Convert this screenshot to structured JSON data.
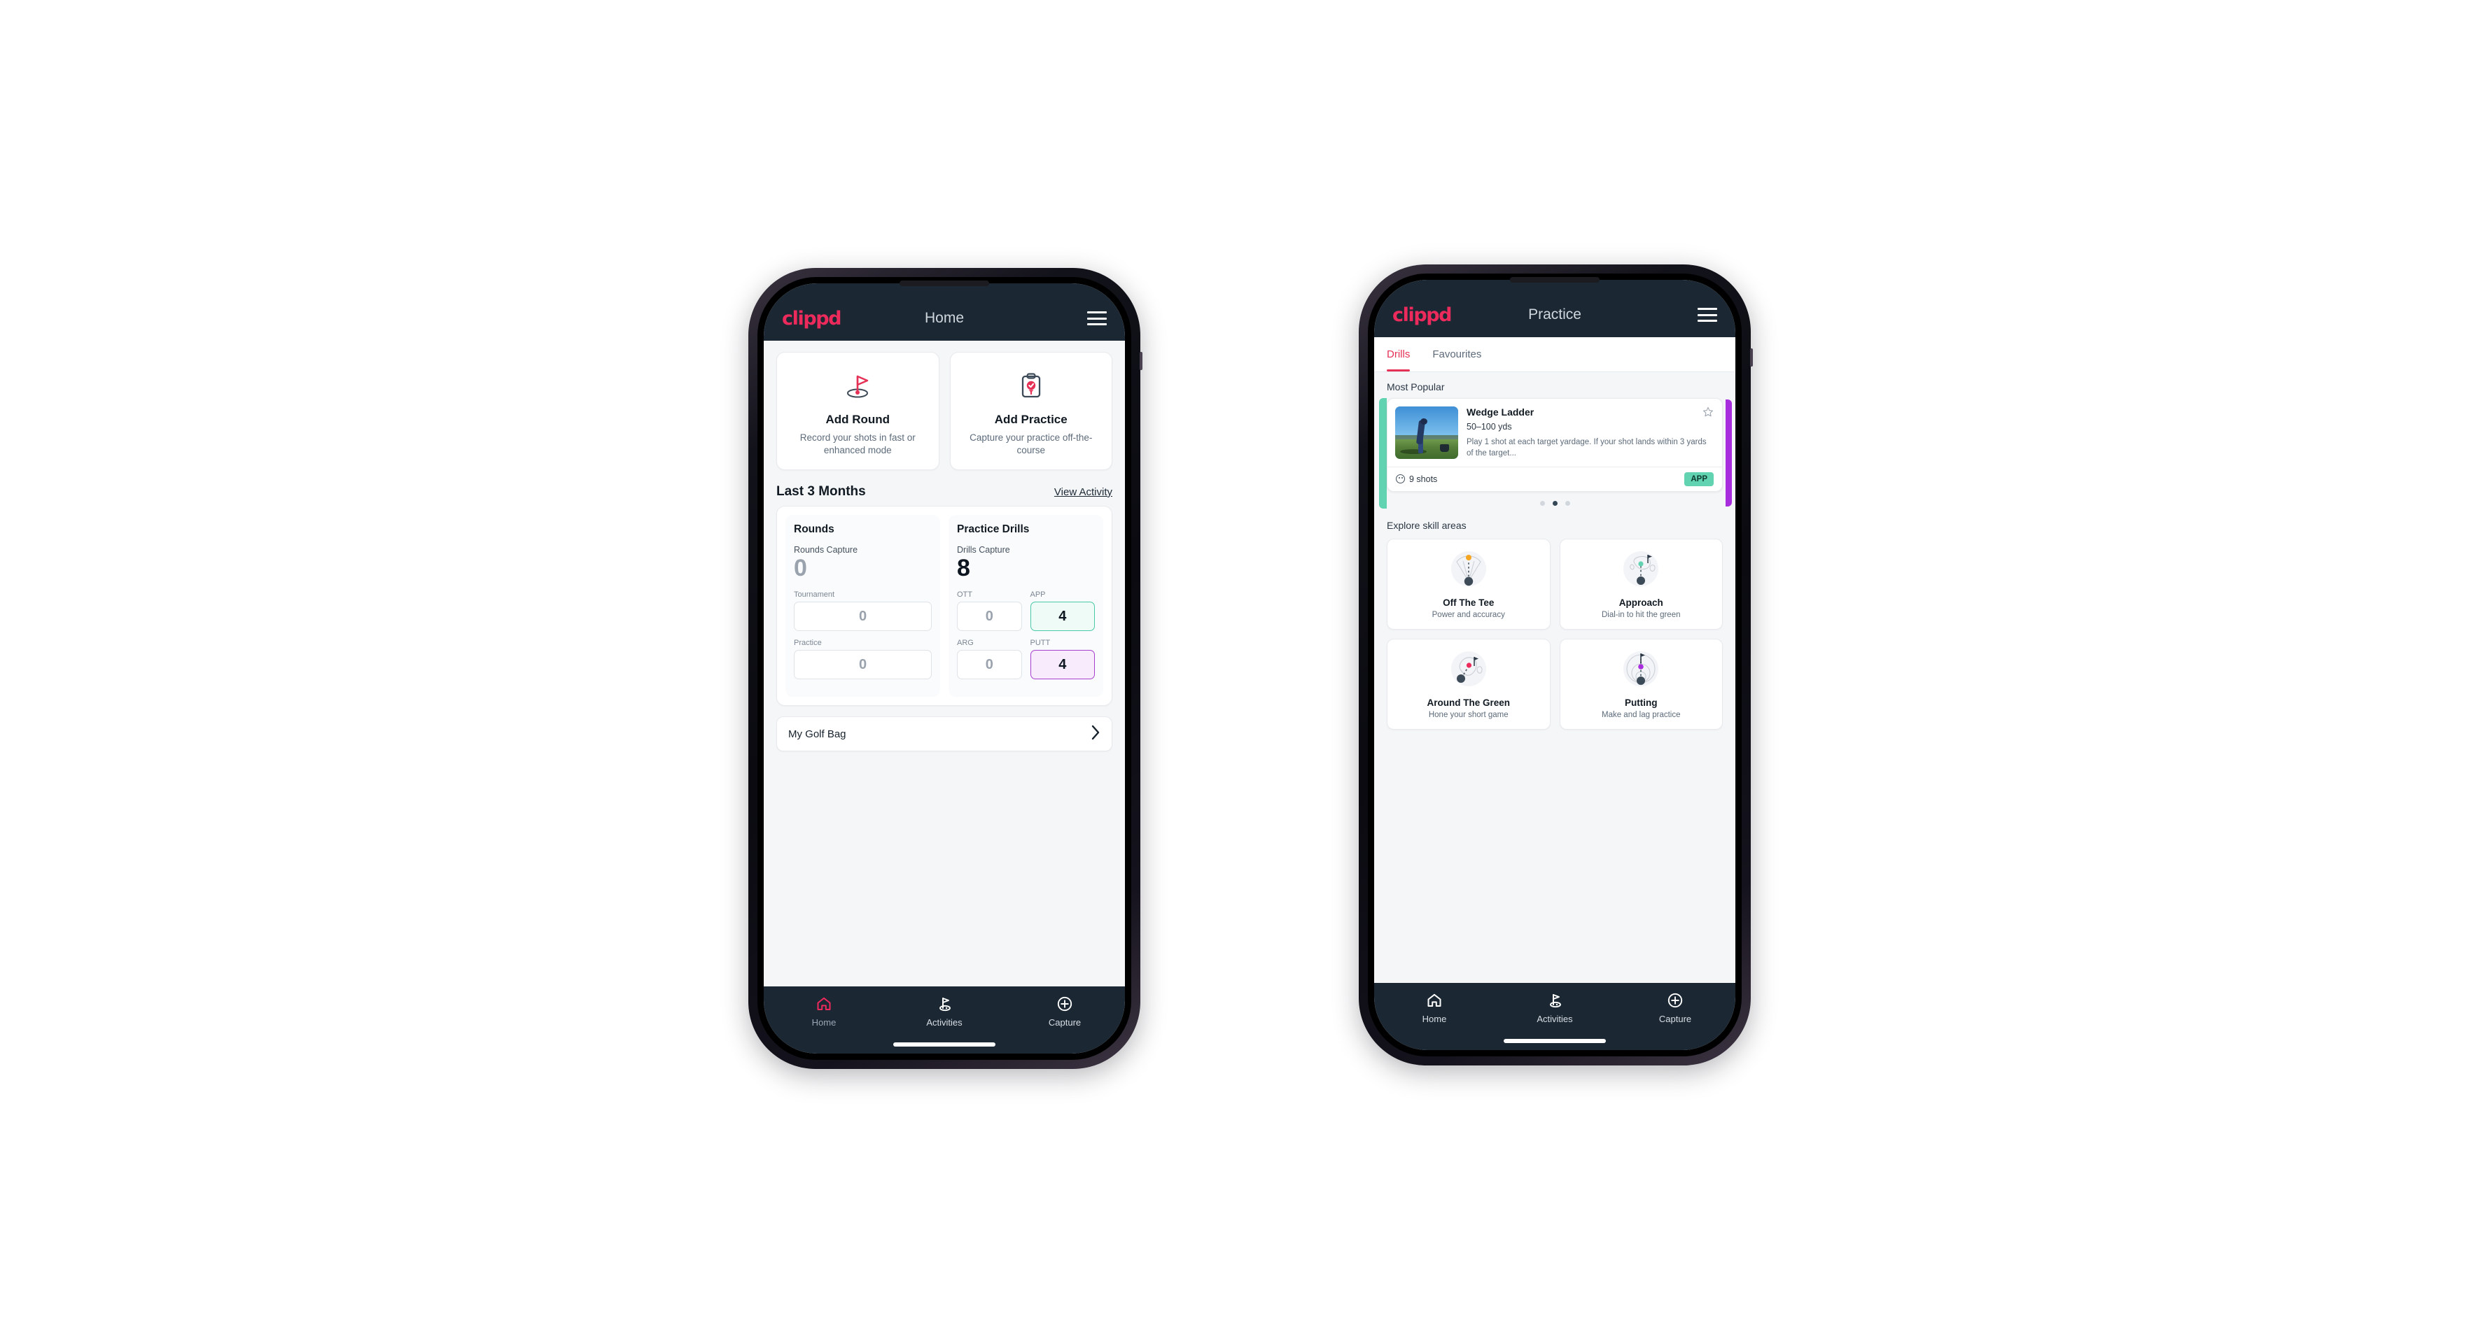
{
  "brand": {
    "logo_text": "clippd",
    "accent": "#ec2a5b",
    "dark": "#1b2834",
    "teal": "#62d3b0",
    "purple": "#a82ddd"
  },
  "phone_home": {
    "appbar": {
      "title": "Home",
      "menu_icon": "hamburger-icon"
    },
    "quick_actions": [
      {
        "icon": "golf-flag-icon",
        "title": "Add Round",
        "subtitle": "Record your shots in fast or enhanced mode"
      },
      {
        "icon": "clipboard-check-icon",
        "title": "Add Practice",
        "subtitle": "Capture your practice off-the-course"
      }
    ],
    "section": {
      "title": "Last 3 Months",
      "link": "View Activity"
    },
    "rounds": {
      "heading": "Rounds",
      "capture_label": "Rounds Capture",
      "capture_value": "0",
      "metrics": [
        {
          "label": "Tournament",
          "value": "0",
          "accent": "none"
        },
        {
          "label": "Practice",
          "value": "0",
          "accent": "none"
        }
      ]
    },
    "drills": {
      "heading": "Practice Drills",
      "capture_label": "Drills Capture",
      "capture_value": "8",
      "metrics": [
        {
          "label": "OTT",
          "value": "0",
          "accent": "none"
        },
        {
          "label": "APP",
          "value": "4",
          "accent": "teal"
        },
        {
          "label": "ARG",
          "value": "0",
          "accent": "none"
        },
        {
          "label": "PUTT",
          "value": "4",
          "accent": "purple"
        }
      ]
    },
    "golf_bag": {
      "label": "My Golf Bag",
      "chevron": "chevron-right-icon"
    },
    "bottom_nav": [
      {
        "icon": "home-icon",
        "label": "Home",
        "active": true
      },
      {
        "icon": "golf-flag-icon",
        "label": "Activities",
        "active": false
      },
      {
        "icon": "plus-circle-icon",
        "label": "Capture",
        "active": false
      }
    ]
  },
  "phone_practice": {
    "appbar": {
      "title": "Practice",
      "menu_icon": "hamburger-icon"
    },
    "tabs": [
      {
        "label": "Drills",
        "active": true
      },
      {
        "label": "Favourites",
        "active": false
      }
    ],
    "most_popular_label": "Most Popular",
    "drill_card": {
      "title": "Wedge Ladder",
      "yardage": "50–100 yds",
      "description": "Play 1 shot at each target yardage. If your shot lands within 3 yards of the target...",
      "shots": "9 shots",
      "tag": "APP",
      "star_icon": "star-outline-icon",
      "shots_icon": "golf-ball-icon"
    },
    "carousel_dots": {
      "count": 3,
      "active_index": 1
    },
    "skill_section_label": "Explore skill areas",
    "skill_areas": [
      {
        "name": "Off The Tee",
        "desc": "Power and accuracy",
        "art": "tee-fan-icon"
      },
      {
        "name": "Approach",
        "desc": "Dial-in to hit the green",
        "art": "approach-green-icon"
      },
      {
        "name": "Around The Green",
        "desc": "Hone your short game",
        "art": "chip-green-icon"
      },
      {
        "name": "Putting",
        "desc": "Make and lag practice",
        "art": "putting-rings-icon"
      }
    ],
    "bottom_nav": [
      {
        "icon": "home-icon",
        "label": "Home",
        "active": false
      },
      {
        "icon": "golf-flag-icon",
        "label": "Activities",
        "active": true
      },
      {
        "icon": "plus-circle-icon",
        "label": "Capture",
        "active": false
      }
    ]
  }
}
